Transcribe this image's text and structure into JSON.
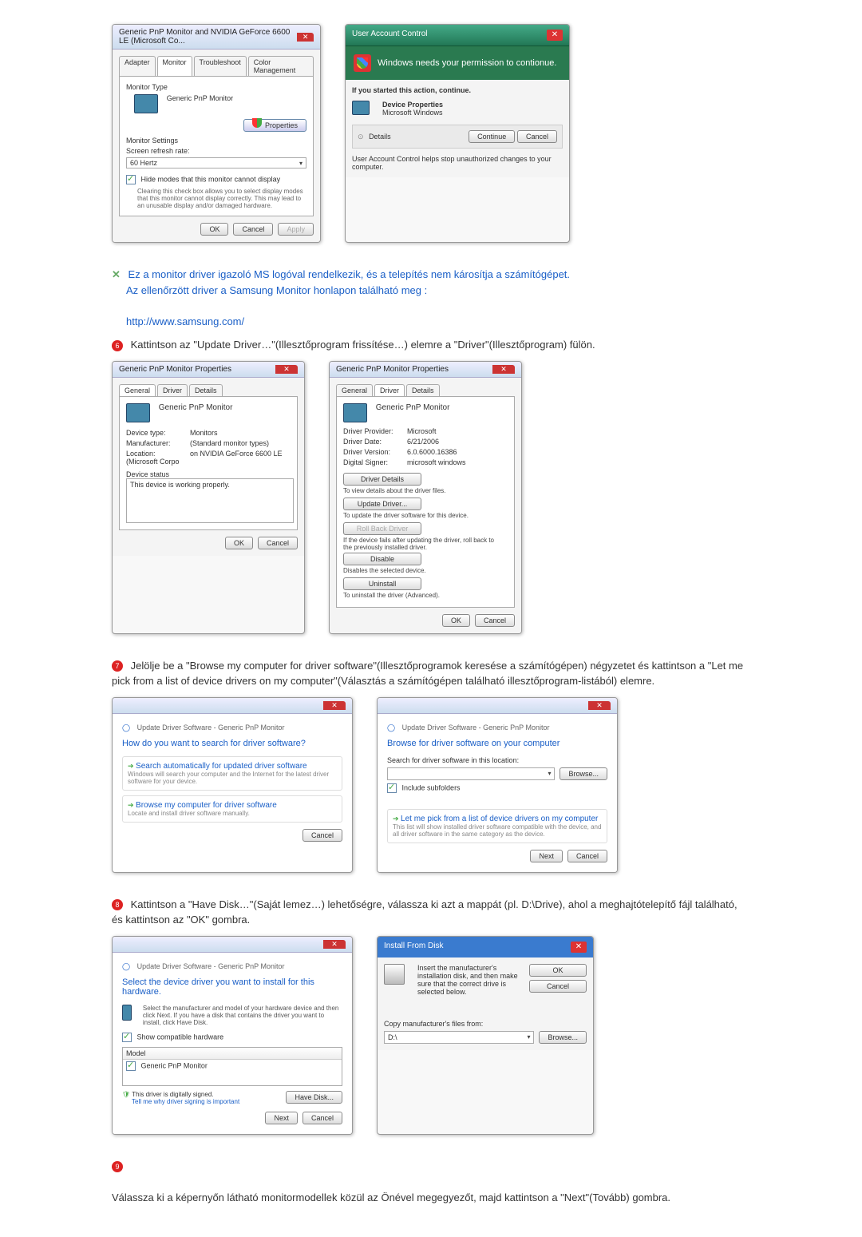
{
  "row1": {
    "monitor_props": {
      "title": "Generic PnP Monitor and NVIDIA GeForce 6600 LE (Microsoft Co...",
      "tabs": [
        "Adapter",
        "Monitor",
        "Troubleshoot",
        "Color Management"
      ],
      "sec1_title": "Monitor Type",
      "monitor_name": "Generic PnP Monitor",
      "properties_btn": "Properties",
      "sec2_title": "Monitor Settings",
      "refresh_label": "Screen refresh rate:",
      "refresh_value": "60 Hertz",
      "hide_modes": "Hide modes that this monitor cannot display",
      "hide_desc": "Clearing this check box allows you to select display modes that this monitor cannot display correctly. This may lead to an unusable display and/or damaged hardware.",
      "ok": "OK",
      "cancel": "Cancel",
      "apply": "Apply"
    },
    "uac": {
      "title": "User Account Control",
      "banner": "Windows needs your permission to contionue.",
      "started": "If you started this action, continue.",
      "device_props": "Device Properties",
      "msw": "Microsoft Windows",
      "details": "Details",
      "continue": "Continue",
      "cancel": "Cancel",
      "footer": "User Account Control helps stop unauthorized changes to your computer."
    }
  },
  "text1": {
    "line1": "Ez a monitor driver igazoló MS logóval rendelkezik, és a telepítés nem károsítja a számítógépet.",
    "line2": "Az ellenőrzött driver a Samsung Monitor honlapon található meg :",
    "link": "http://www.samsung.com/"
  },
  "step6": {
    "num": "6",
    "text": "Kattintson az \"Update Driver…\"(Illesztőprogram frissítése…) elemre a \"Driver\"(Illesztőprogram) fülön."
  },
  "row2": {
    "propsA": {
      "title": "Generic PnP Monitor Properties",
      "tabs": [
        "General",
        "Driver",
        "Details"
      ],
      "header": "Generic PnP Monitor",
      "device_type_label": "Device type:",
      "device_type": "Monitors",
      "manufacturer_label": "Manufacturer:",
      "manufacturer": "(Standard monitor types)",
      "location_label": "Location:",
      "location": "on NVIDIA GeForce 6600 LE (Microsoft Corpo",
      "status_title": "Device status",
      "status": "This device is working properly.",
      "ok": "OK",
      "cancel": "Cancel"
    },
    "propsB": {
      "title": "Generic PnP Monitor Properties",
      "tabs": [
        "General",
        "Driver",
        "Details"
      ],
      "header": "Generic PnP Monitor",
      "provider_label": "Driver Provider:",
      "provider": "Microsoft",
      "date_label": "Driver Date:",
      "date": "6/21/2006",
      "version_label": "Driver Version:",
      "version": "6.0.6000.16386",
      "signer_label": "Digital Signer:",
      "signer": "microsoft windows",
      "driver_details_btn": "Driver Details",
      "driver_details_desc": "To view details about the driver files.",
      "update_btn": "Update Driver...",
      "update_desc": "To update the driver software for this device.",
      "rollback_btn": "Roll Back Driver",
      "rollback_desc": "If the device fails after updating the driver, roll back to the previously installed driver.",
      "disable_btn": "Disable",
      "disable_desc": "Disables the selected device.",
      "uninstall_btn": "Uninstall",
      "uninstall_desc": "To uninstall the driver (Advanced).",
      "ok": "OK",
      "cancel": "Cancel"
    }
  },
  "step7": {
    "num": "7",
    "text": "Jelölje be a \"Browse my computer for driver software\"(Illesztőprogramok keresése a számítógépen) négyzetet és kattintson a \"Let me pick from a list of device drivers on my computer\"(Választás a számítógépen található illesztőprogram-listából) elemre."
  },
  "row3": {
    "wizA": {
      "crumb": "Update Driver Software - Generic PnP Monitor",
      "title": "How do you want to search for driver software?",
      "opt1_title": "Search automatically for updated driver software",
      "opt1_desc": "Windows will search your computer and the Internet for the latest driver software for your device.",
      "opt2_title": "Browse my computer for driver software",
      "opt2_desc": "Locate and install driver software manually.",
      "cancel": "Cancel"
    },
    "wizB": {
      "crumb": "Update Driver Software - Generic PnP Monitor",
      "title": "Browse for driver software on your computer",
      "search_label": "Search for driver software in this location:",
      "browse": "Browse...",
      "include_sub": "Include subfolders",
      "opt_title": "Let me pick from a list of device drivers on my computer",
      "opt_desc": "This list will show installed driver software compatible with the device, and all driver software in the same category as the device.",
      "next": "Next",
      "cancel": "Cancel"
    }
  },
  "step8": {
    "num": "8",
    "text": "Kattintson a \"Have Disk…\"(Saját lemez…) lehetőségre, válassza ki azt a mappát (pl. D:\\Drive), ahol a meghajtótelepítő fájl található, és kattintson az \"OK\" gombra."
  },
  "row4": {
    "wizC": {
      "crumb": "Update Driver Software - Generic PnP Monitor",
      "title": "Select the device driver you want to install for this hardware.",
      "instr": "Select the manufacturer and model of your hardware device and then click Next. If you have a disk that contains the driver you want to install, click Have Disk.",
      "show_compat": "Show compatible hardware",
      "model_hdr": "Model",
      "model_item": "Generic PnP Monitor",
      "signed": "This driver is digitally signed.",
      "tellme": "Tell me why driver signing is important",
      "have_disk": "Have Disk...",
      "next": "Next",
      "cancel": "Cancel"
    },
    "disk": {
      "title": "Install From Disk",
      "instr": "Insert the manufacturer's installation disk, and then make sure that the correct drive is selected below.",
      "ok": "OK",
      "cancel": "Cancel",
      "copy_label": "Copy manufacturer's files from:",
      "path": "D:\\",
      "browse": "Browse..."
    }
  },
  "step9": {
    "num": "9",
    "text": "Válassza ki a képernyőn látható monitormodellek közül az Önével megegyezőt, majd kattintson a \"Next\"(Tovább) gombra."
  }
}
